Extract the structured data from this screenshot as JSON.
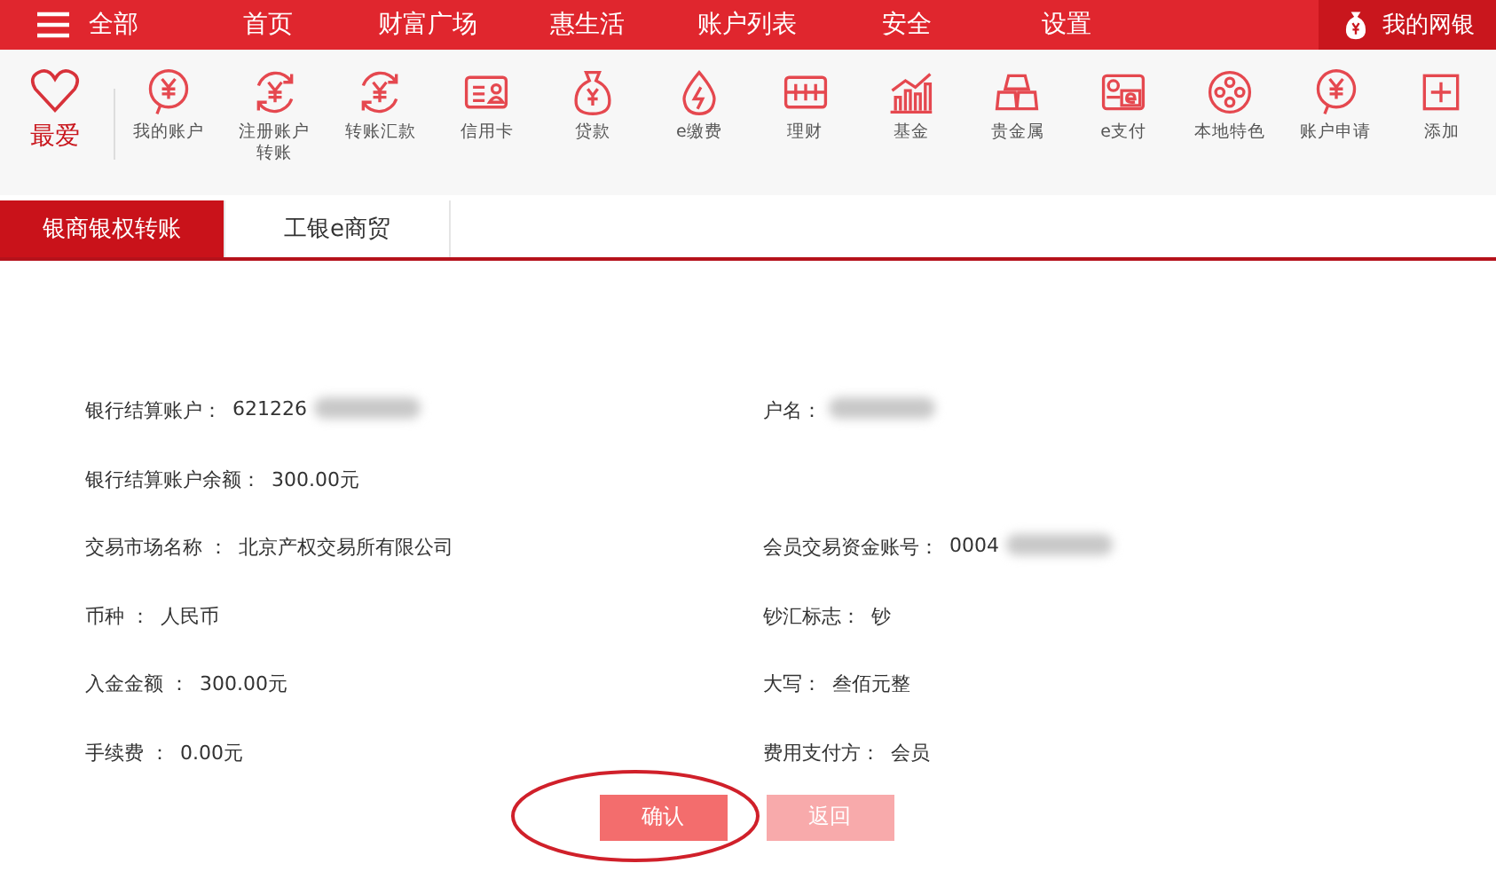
{
  "nav": {
    "items": [
      {
        "label": "全部"
      },
      {
        "label": "首页"
      },
      {
        "label": "财富广场"
      },
      {
        "label": "惠生活"
      },
      {
        "label": "账户列表"
      },
      {
        "label": "安全"
      },
      {
        "label": "设置"
      }
    ],
    "my_bank": "我的网银"
  },
  "favorites": {
    "title": "最爱",
    "items": [
      {
        "label": "我的账户"
      },
      {
        "label": "注册账户转账"
      },
      {
        "label": "转账汇款"
      },
      {
        "label": "信用卡"
      },
      {
        "label": "贷款"
      },
      {
        "label": "e缴费"
      },
      {
        "label": "理财"
      },
      {
        "label": "基金"
      },
      {
        "label": "贵金属"
      },
      {
        "label": "e支付"
      },
      {
        "label": "本地特色"
      },
      {
        "label": "账户申请"
      },
      {
        "label": "添加"
      }
    ]
  },
  "tabs": [
    {
      "label": "银商银权转账",
      "selected": true
    },
    {
      "label": "工银e商贸",
      "selected": false
    }
  ],
  "rows": [
    {
      "left": {
        "label": "银行结算账户：",
        "value": "621226",
        "masked": true
      },
      "right": {
        "label": "户名：",
        "masked": true
      }
    },
    {
      "left": {
        "label": "银行结算账户余额：",
        "value": "300.00元",
        "masked": false
      }
    },
    {
      "left": {
        "label": "交易市场名称 ：",
        "value": "北京产权交易所有限公司",
        "masked": false
      },
      "right": {
        "label": "会员交易资金账号：",
        "value": "0004",
        "masked": true
      }
    },
    {
      "left": {
        "label": "币种 ：",
        "value": "人民币",
        "masked": false
      },
      "right": {
        "label": "钞汇标志：",
        "value": "钞",
        "masked": false
      }
    },
    {
      "left": {
        "label": "入金金额 ：",
        "value": "300.00元",
        "masked": false
      },
      "right": {
        "label": "大写：",
        "value": "叁佰元整",
        "masked": false
      }
    },
    {
      "left": {
        "label": "手续费 ：",
        "value": "0.00元",
        "masked": false
      },
      "right": {
        "label": "费用支付方：",
        "value": "会员",
        "masked": false
      }
    }
  ],
  "buttons": [
    {
      "label": "确认",
      "kind": "primary",
      "circled": true
    },
    {
      "label": "返回",
      "kind": "secondary",
      "circled": false
    }
  ]
}
